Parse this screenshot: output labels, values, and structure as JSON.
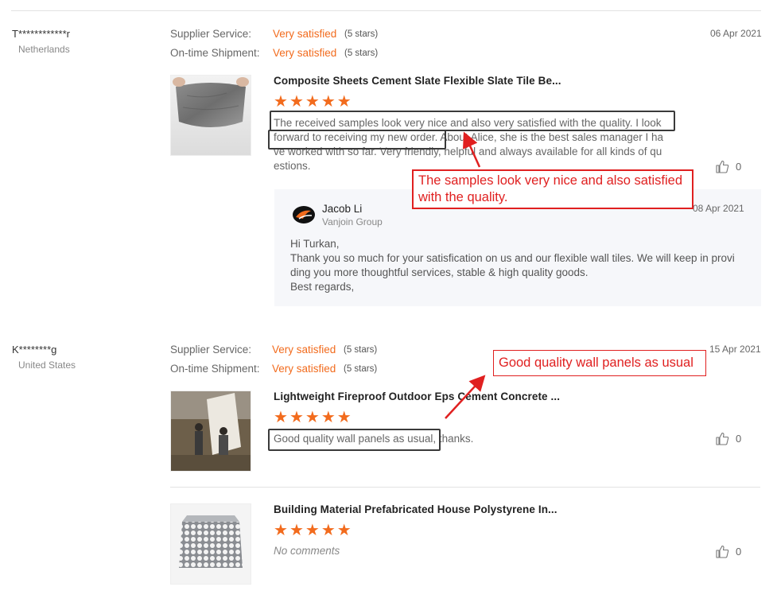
{
  "labels": {
    "supplier_service": "Supplier Service:",
    "ontime_shipment": "On-time Shipment:"
  },
  "reviews": [
    {
      "buyer": "T************r",
      "country": "Netherlands",
      "supplier_service": "Very satisfied",
      "supplier_service_stars": "(5 stars)",
      "ontime_shipment": "Very satisfied",
      "ontime_shipment_stars": "(5 stars)",
      "date": "06 Apr 2021",
      "products": [
        {
          "title": "Composite Sheets Cement Slate Flexible Slate Tile Be...",
          "rating": 5,
          "comment_lines": [
            "The received samples look very nice and also very satisfied with the quality. I look",
            "forward to receiving my new order. About Alice, she is the best sales manager I ha",
            "ve worked with so far. Very friendly, helpful and always available for all kinds of qu",
            "estions."
          ],
          "likes": "0",
          "reply": {
            "name": "Jacob Li",
            "company": "Vanjoin Group",
            "date": "08 Apr 2021",
            "text": "Hi Turkan,\nThank you so much for your satisfication on us and our flexible wall tiles. We will keep in provi\nding you more thoughtful services, stable & high quality goods.\nBest regards,"
          }
        }
      ]
    },
    {
      "buyer": "K********g",
      "country": "United States",
      "supplier_service": "Very satisfied",
      "supplier_service_stars": "(5 stars)",
      "ontime_shipment": "Very satisfied",
      "ontime_shipment_stars": "(5 stars)",
      "date": "15 Apr 2021",
      "products": [
        {
          "title": "Lightweight Fireproof Outdoor Eps Cement Concrete ...",
          "rating": 5,
          "comment": "Good quality wall panels as usual, thanks.",
          "likes": "0"
        },
        {
          "title": "Building Material Prefabricated House Polystyrene In...",
          "rating": 5,
          "comment": "No comments",
          "likes": "0"
        }
      ]
    }
  ],
  "annotations": {
    "note1": "The samples look very nice and also satisfied with the quality.",
    "note2": "Good quality wall panels as usual"
  },
  "colors": {
    "accent": "#f26b1d",
    "annotation": "#e02020"
  },
  "icons": {
    "like": "thumbs-up-icon",
    "star": "star-icon",
    "logo": "company-logo"
  }
}
